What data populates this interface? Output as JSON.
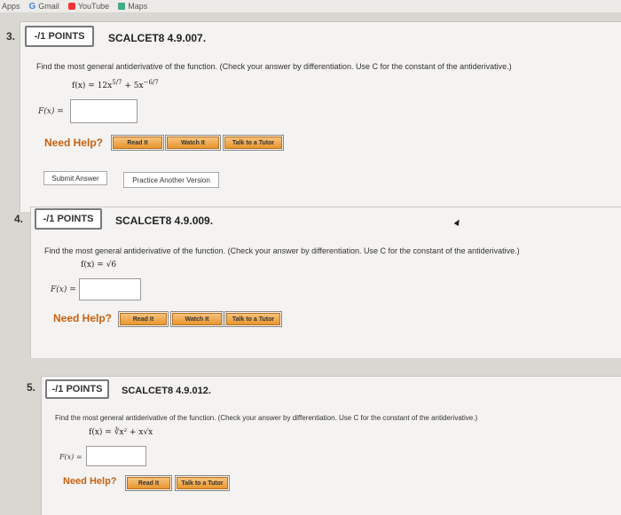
{
  "bookmarks": [
    {
      "label": "Apps",
      "icon": "apps-icon"
    },
    {
      "label": "Gmail",
      "icon": "gmail-icon"
    },
    {
      "label": "YouTube",
      "icon": "youtube-icon"
    },
    {
      "label": "Maps",
      "icon": "maps-icon"
    }
  ],
  "questions": [
    {
      "number": "3.",
      "points": "-/1 POINTS",
      "code": "SCALCET8 4.9.007.",
      "prompt": "Find the most general antiderivative of the function. (Check your answer by differentiation. Use C for the constant of the antiderivative.)",
      "equation": "f(x) = 12x",
      "exp1": "5/7",
      "eq_mid": " + 5x",
      "exp2": "−6/7",
      "answer_label": "F(x) =",
      "answer_value": "",
      "help_label": "Need Help?",
      "help_buttons": [
        "Read It",
        "Watch It",
        "Talk to a Tutor"
      ],
      "submit_label": "Submit Answer",
      "practice_label": "Practice Another Version"
    },
    {
      "number": "4.",
      "points": "-/1 POINTS",
      "code": "SCALCET8 4.9.009.",
      "prompt": "Find the most general antiderivative of the function. (Check your answer by differentiation. Use C for the constant of the antiderivative.)",
      "equation": "f(x) = √6",
      "answer_label": "F(x) =",
      "answer_value": "",
      "help_label": "Need Help?",
      "help_buttons": [
        "Read It",
        "Watch It",
        "Talk to a Tutor"
      ]
    },
    {
      "number": "5.",
      "points": "-/1 POINTS",
      "code": "SCALCET8 4.9.012.",
      "prompt": "Find the most general antiderivative of the function. (Check your answer by differentiation. Use C for the constant of the antiderivative.)",
      "equation": "f(x) = ∛x² + x√x",
      "answer_label": "F(x) =",
      "answer_value": "",
      "help_label": "Need Help?",
      "help_buttons": [
        "Read It",
        "Talk to a Tutor"
      ]
    }
  ]
}
